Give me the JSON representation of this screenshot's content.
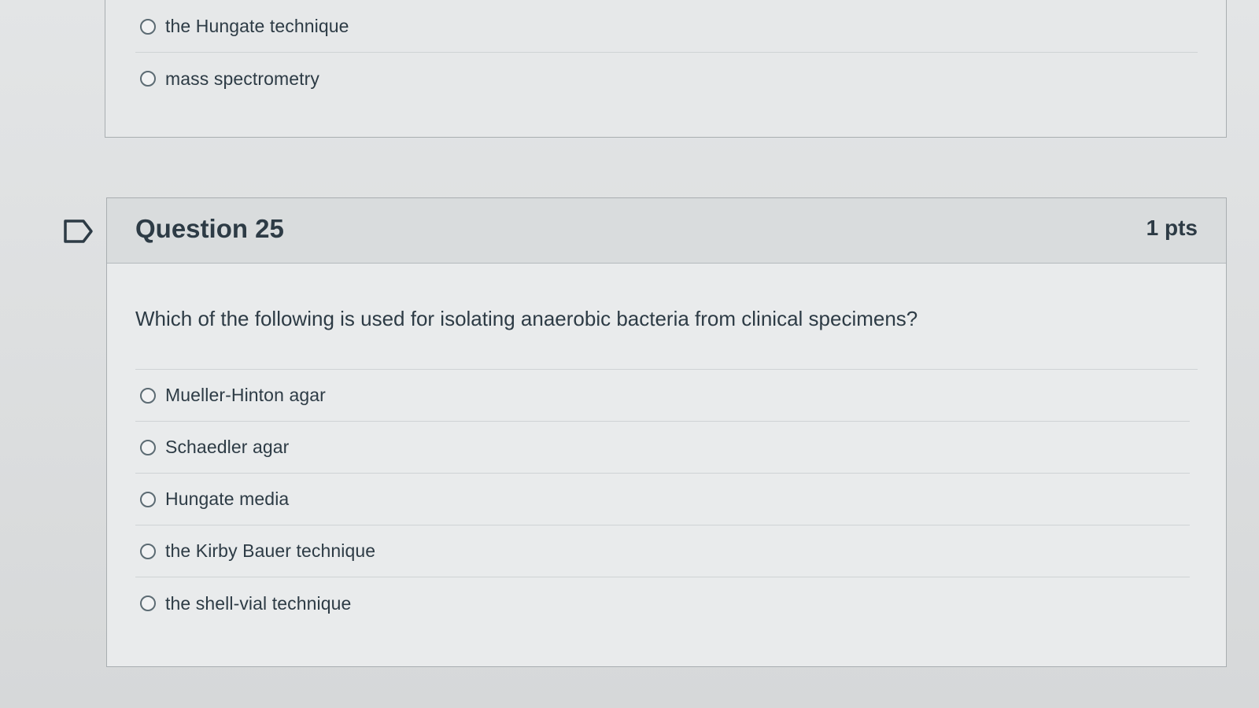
{
  "previous_question": {
    "answers": [
      {
        "label": "the Hungate technique"
      },
      {
        "label": "mass spectrometry"
      }
    ]
  },
  "question": {
    "title": "Question 25",
    "points": "1 pts",
    "text": "Which of the following is used for isolating anaerobic bacteria from clinical specimens?",
    "answers": [
      {
        "label": "Mueller-Hinton agar"
      },
      {
        "label": "Schaedler agar"
      },
      {
        "label": "Hungate media"
      },
      {
        "label": "the Kirby Bauer technique"
      },
      {
        "label": "the shell-vial technique"
      }
    ]
  },
  "icons": {
    "flag": "bookmark-flag-icon",
    "radio": "radio-button-icon"
  },
  "colors": {
    "text": "#2d3b45",
    "card_border": "#a9aeb1",
    "header_bg": "#d9dcdd"
  }
}
